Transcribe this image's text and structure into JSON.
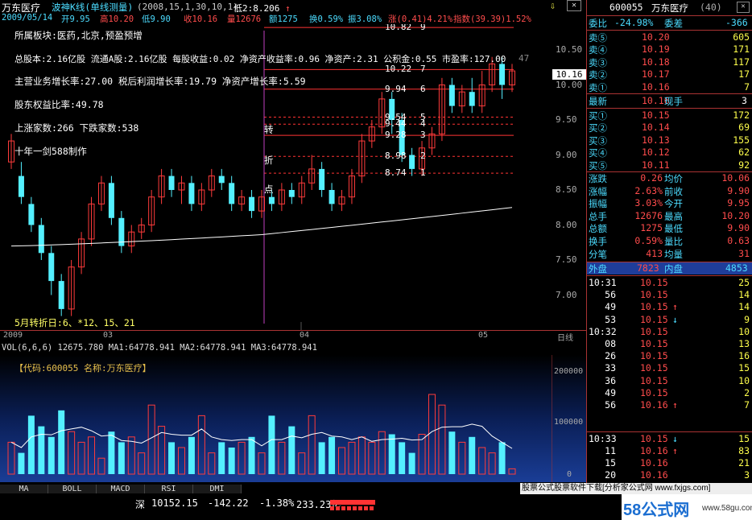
{
  "header": {
    "name": "万东医疗",
    "mode": "波神K线(单线测量)",
    "params": "(2008,15,1,30,10,1)",
    "low_label": "低2:8.206",
    "date": "2009/05/14",
    "open": "开9.95",
    "high": "高10.20",
    "low": "低9.90",
    "close": "收10.16",
    "volume": "量12676",
    "amount": "额1275",
    "turnover": "换0.59%",
    "amplitude": "振3.08%",
    "change": "涨(0.41)4.21%",
    "index": "指数(39.39)1.52%"
  },
  "overlay": {
    "sector": "所属板块:医药,北京,预盈预增",
    "shares": "总股本:2.16亿股  流通A股:2.16亿股  每股收益:0.02  净资产收益率:0.96  净资产:2.31  公积金:0.55  市盈率:127.00",
    "growth": "主营业务增长率:27.00  税后利润增长率:19.79  净资产增长率:5.59",
    "equity": "股东权益比率:49.78",
    "updown": "上涨家数:266    下跌家数:538",
    "credit": "十年一剑588制作",
    "turn_date": "5月转折日:6、*12、15、21",
    "mark1": "转",
    "mark2": "折",
    "mark3": "点"
  },
  "levels": [
    {
      "price": "10.82",
      "num": "9"
    },
    {
      "price": "10.22",
      "num": "7"
    },
    {
      "price": "9.94",
      "num": "6"
    },
    {
      "price": "9.54",
      "num": "5"
    },
    {
      "price": "9.44",
      "num": "4"
    },
    {
      "price": "9.28",
      "num": "3"
    },
    {
      "price": "8.98",
      "num": "2"
    },
    {
      "price": "8.74",
      "num": "1"
    }
  ],
  "price_axis": [
    "10.50",
    "10.00",
    "9.50",
    "9.00",
    "8.50",
    "8.00",
    "7.50",
    "7.00"
  ],
  "price_tag": "10.16",
  "hi_tag": "47",
  "xaxis": [
    "2009",
    "03",
    "04",
    "05",
    "日线"
  ],
  "vol": {
    "header": "VOL(6,6,6)  12675.780  MA1:64778.941  MA2:64778.941  MA3:64778.941",
    "label": "【代码:600055 名称:万东医疗】",
    "axis": [
      "200000",
      "100000",
      "0"
    ]
  },
  "tabs": [
    "MA",
    "BOLL",
    "MACD",
    "RSI",
    "DMI"
  ],
  "status": {
    "label": "深",
    "index": "10152.15",
    "chg": "-142.22",
    "pct": "-1.38%",
    "amount": "233.23亿",
    "promo": "股票公式股票软件下载[分析家公式网 www.fxjgs.com]",
    "brand": "58公式网",
    "url": "www.58gu.com"
  },
  "right": {
    "code": "600055",
    "name": "万东医疗",
    "num": "(40)",
    "weibi_label": "委比",
    "weibi": "-24.98%",
    "weicha_label": "委差",
    "weicha": "-366",
    "asks": [
      {
        "label": "卖⑤",
        "price": "10.20",
        "vol": "605"
      },
      {
        "label": "卖④",
        "price": "10.19",
        "vol": "171"
      },
      {
        "label": "卖③",
        "price": "10.18",
        "vol": "117"
      },
      {
        "label": "卖②",
        "price": "10.17",
        "vol": "17"
      },
      {
        "label": "卖①",
        "price": "10.16",
        "vol": "7"
      }
    ],
    "last_label": "最新",
    "last": "10.16",
    "xs_label": "现手",
    "xs": "3",
    "bids": [
      {
        "label": "买①",
        "price": "10.15",
        "vol": "172"
      },
      {
        "label": "买②",
        "price": "10.14",
        "vol": "69"
      },
      {
        "label": "买③",
        "price": "10.13",
        "vol": "155"
      },
      {
        "label": "买④",
        "price": "10.12",
        "vol": "62"
      },
      {
        "label": "买⑤",
        "price": "10.11",
        "vol": "92"
      }
    ],
    "stats": [
      {
        "l1": "涨跌",
        "v1": "0.26",
        "l2": "均价",
        "v2": "10.06"
      },
      {
        "l1": "涨幅",
        "v1": "2.63%",
        "l2": "前收",
        "v2": "9.90"
      },
      {
        "l1": "振幅",
        "v1": "3.03%",
        "l2": "今开",
        "v2": "9.95"
      },
      {
        "l1": "总手",
        "v1": "12676",
        "l2": "最高",
        "v2": "10.20"
      },
      {
        "l1": "总额",
        "v1": "1275",
        "l2": "最低",
        "v2": "9.90"
      },
      {
        "l1": "换手",
        "v1": "0.59%",
        "l2": "量比",
        "v2": "0.63"
      },
      {
        "l1": "分笔",
        "v1": "413",
        "l2": "均量",
        "v2": "31"
      }
    ],
    "waipan_label": "外盘",
    "waipan": "7823",
    "neipan_label": "内盘",
    "neipan": "4853",
    "ticks": [
      {
        "t": "10:31",
        "p": "10.15",
        "a": "",
        "v": "25"
      },
      {
        "t": "56",
        "p": "10.15",
        "a": "",
        "v": "14"
      },
      {
        "t": "49",
        "p": "10.15",
        "a": "↑",
        "v": "14"
      },
      {
        "t": "53",
        "p": "10.15",
        "a": "↓",
        "v": "9"
      },
      {
        "t": "10:32",
        "p": "10.15",
        "a": "",
        "v": "10"
      },
      {
        "t": "08",
        "p": "10.15",
        "a": "",
        "v": "13"
      },
      {
        "t": "26",
        "p": "10.15",
        "a": "",
        "v": "16"
      },
      {
        "t": "33",
        "p": "10.15",
        "a": "",
        "v": "15"
      },
      {
        "t": "36",
        "p": "10.15",
        "a": "",
        "v": "10"
      },
      {
        "t": "49",
        "p": "10.15",
        "a": "",
        "v": "2"
      },
      {
        "t": "56",
        "p": "10.16",
        "a": "↑",
        "v": "7"
      }
    ],
    "ticks2": [
      {
        "t": "10:33",
        "p": "10.15",
        "a": "↓",
        "v": "15"
      },
      {
        "t": "11",
        "p": "10.16",
        "a": "↑",
        "v": "83"
      },
      {
        "t": "15",
        "p": "10.16",
        "a": "",
        "v": "21"
      },
      {
        "t": "20",
        "p": "10.16",
        "a": "",
        "v": "3"
      }
    ]
  },
  "colors": {
    "up": "#ff3b3b",
    "down": "#54f0ff",
    "ma": "#ffffff",
    "magenta": "#c040c0"
  }
}
